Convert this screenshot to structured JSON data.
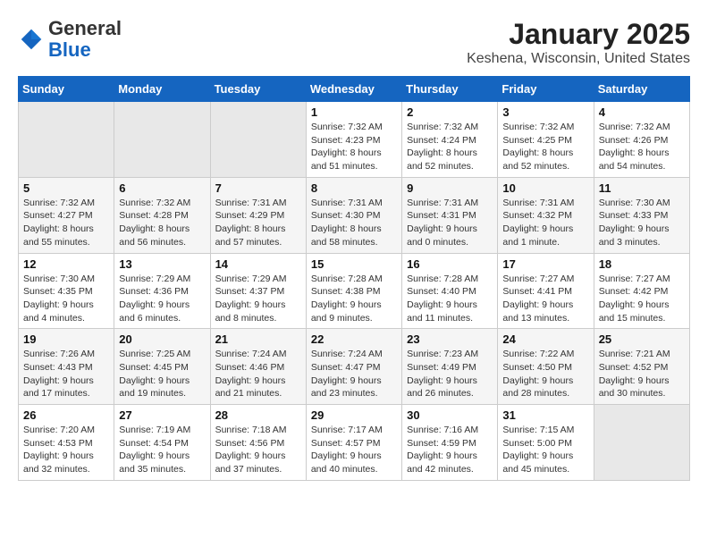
{
  "header": {
    "logo_general": "General",
    "logo_blue": "Blue",
    "month_title": "January 2025",
    "location": "Keshena, Wisconsin, United States"
  },
  "weekdays": [
    "Sunday",
    "Monday",
    "Tuesday",
    "Wednesday",
    "Thursday",
    "Friday",
    "Saturday"
  ],
  "weeks": [
    [
      {
        "day": "",
        "sunrise": "",
        "sunset": "",
        "daylight": ""
      },
      {
        "day": "",
        "sunrise": "",
        "sunset": "",
        "daylight": ""
      },
      {
        "day": "",
        "sunrise": "",
        "sunset": "",
        "daylight": ""
      },
      {
        "day": "1",
        "sunrise": "Sunrise: 7:32 AM",
        "sunset": "Sunset: 4:23 PM",
        "daylight": "Daylight: 8 hours and 51 minutes."
      },
      {
        "day": "2",
        "sunrise": "Sunrise: 7:32 AM",
        "sunset": "Sunset: 4:24 PM",
        "daylight": "Daylight: 8 hours and 52 minutes."
      },
      {
        "day": "3",
        "sunrise": "Sunrise: 7:32 AM",
        "sunset": "Sunset: 4:25 PM",
        "daylight": "Daylight: 8 hours and 52 minutes."
      },
      {
        "day": "4",
        "sunrise": "Sunrise: 7:32 AM",
        "sunset": "Sunset: 4:26 PM",
        "daylight": "Daylight: 8 hours and 54 minutes."
      }
    ],
    [
      {
        "day": "5",
        "sunrise": "Sunrise: 7:32 AM",
        "sunset": "Sunset: 4:27 PM",
        "daylight": "Daylight: 8 hours and 55 minutes."
      },
      {
        "day": "6",
        "sunrise": "Sunrise: 7:32 AM",
        "sunset": "Sunset: 4:28 PM",
        "daylight": "Daylight: 8 hours and 56 minutes."
      },
      {
        "day": "7",
        "sunrise": "Sunrise: 7:31 AM",
        "sunset": "Sunset: 4:29 PM",
        "daylight": "Daylight: 8 hours and 57 minutes."
      },
      {
        "day": "8",
        "sunrise": "Sunrise: 7:31 AM",
        "sunset": "Sunset: 4:30 PM",
        "daylight": "Daylight: 8 hours and 58 minutes."
      },
      {
        "day": "9",
        "sunrise": "Sunrise: 7:31 AM",
        "sunset": "Sunset: 4:31 PM",
        "daylight": "Daylight: 9 hours and 0 minutes."
      },
      {
        "day": "10",
        "sunrise": "Sunrise: 7:31 AM",
        "sunset": "Sunset: 4:32 PM",
        "daylight": "Daylight: 9 hours and 1 minute."
      },
      {
        "day": "11",
        "sunrise": "Sunrise: 7:30 AM",
        "sunset": "Sunset: 4:33 PM",
        "daylight": "Daylight: 9 hours and 3 minutes."
      }
    ],
    [
      {
        "day": "12",
        "sunrise": "Sunrise: 7:30 AM",
        "sunset": "Sunset: 4:35 PM",
        "daylight": "Daylight: 9 hours and 4 minutes."
      },
      {
        "day": "13",
        "sunrise": "Sunrise: 7:29 AM",
        "sunset": "Sunset: 4:36 PM",
        "daylight": "Daylight: 9 hours and 6 minutes."
      },
      {
        "day": "14",
        "sunrise": "Sunrise: 7:29 AM",
        "sunset": "Sunset: 4:37 PM",
        "daylight": "Daylight: 9 hours and 8 minutes."
      },
      {
        "day": "15",
        "sunrise": "Sunrise: 7:28 AM",
        "sunset": "Sunset: 4:38 PM",
        "daylight": "Daylight: 9 hours and 9 minutes."
      },
      {
        "day": "16",
        "sunrise": "Sunrise: 7:28 AM",
        "sunset": "Sunset: 4:40 PM",
        "daylight": "Daylight: 9 hours and 11 minutes."
      },
      {
        "day": "17",
        "sunrise": "Sunrise: 7:27 AM",
        "sunset": "Sunset: 4:41 PM",
        "daylight": "Daylight: 9 hours and 13 minutes."
      },
      {
        "day": "18",
        "sunrise": "Sunrise: 7:27 AM",
        "sunset": "Sunset: 4:42 PM",
        "daylight": "Daylight: 9 hours and 15 minutes."
      }
    ],
    [
      {
        "day": "19",
        "sunrise": "Sunrise: 7:26 AM",
        "sunset": "Sunset: 4:43 PM",
        "daylight": "Daylight: 9 hours and 17 minutes."
      },
      {
        "day": "20",
        "sunrise": "Sunrise: 7:25 AM",
        "sunset": "Sunset: 4:45 PM",
        "daylight": "Daylight: 9 hours and 19 minutes."
      },
      {
        "day": "21",
        "sunrise": "Sunrise: 7:24 AM",
        "sunset": "Sunset: 4:46 PM",
        "daylight": "Daylight: 9 hours and 21 minutes."
      },
      {
        "day": "22",
        "sunrise": "Sunrise: 7:24 AM",
        "sunset": "Sunset: 4:47 PM",
        "daylight": "Daylight: 9 hours and 23 minutes."
      },
      {
        "day": "23",
        "sunrise": "Sunrise: 7:23 AM",
        "sunset": "Sunset: 4:49 PM",
        "daylight": "Daylight: 9 hours and 26 minutes."
      },
      {
        "day": "24",
        "sunrise": "Sunrise: 7:22 AM",
        "sunset": "Sunset: 4:50 PM",
        "daylight": "Daylight: 9 hours and 28 minutes."
      },
      {
        "day": "25",
        "sunrise": "Sunrise: 7:21 AM",
        "sunset": "Sunset: 4:52 PM",
        "daylight": "Daylight: 9 hours and 30 minutes."
      }
    ],
    [
      {
        "day": "26",
        "sunrise": "Sunrise: 7:20 AM",
        "sunset": "Sunset: 4:53 PM",
        "daylight": "Daylight: 9 hours and 32 minutes."
      },
      {
        "day": "27",
        "sunrise": "Sunrise: 7:19 AM",
        "sunset": "Sunset: 4:54 PM",
        "daylight": "Daylight: 9 hours and 35 minutes."
      },
      {
        "day": "28",
        "sunrise": "Sunrise: 7:18 AM",
        "sunset": "Sunset: 4:56 PM",
        "daylight": "Daylight: 9 hours and 37 minutes."
      },
      {
        "day": "29",
        "sunrise": "Sunrise: 7:17 AM",
        "sunset": "Sunset: 4:57 PM",
        "daylight": "Daylight: 9 hours and 40 minutes."
      },
      {
        "day": "30",
        "sunrise": "Sunrise: 7:16 AM",
        "sunset": "Sunset: 4:59 PM",
        "daylight": "Daylight: 9 hours and 42 minutes."
      },
      {
        "day": "31",
        "sunrise": "Sunrise: 7:15 AM",
        "sunset": "Sunset: 5:00 PM",
        "daylight": "Daylight: 9 hours and 45 minutes."
      },
      {
        "day": "",
        "sunrise": "",
        "sunset": "",
        "daylight": ""
      }
    ]
  ]
}
